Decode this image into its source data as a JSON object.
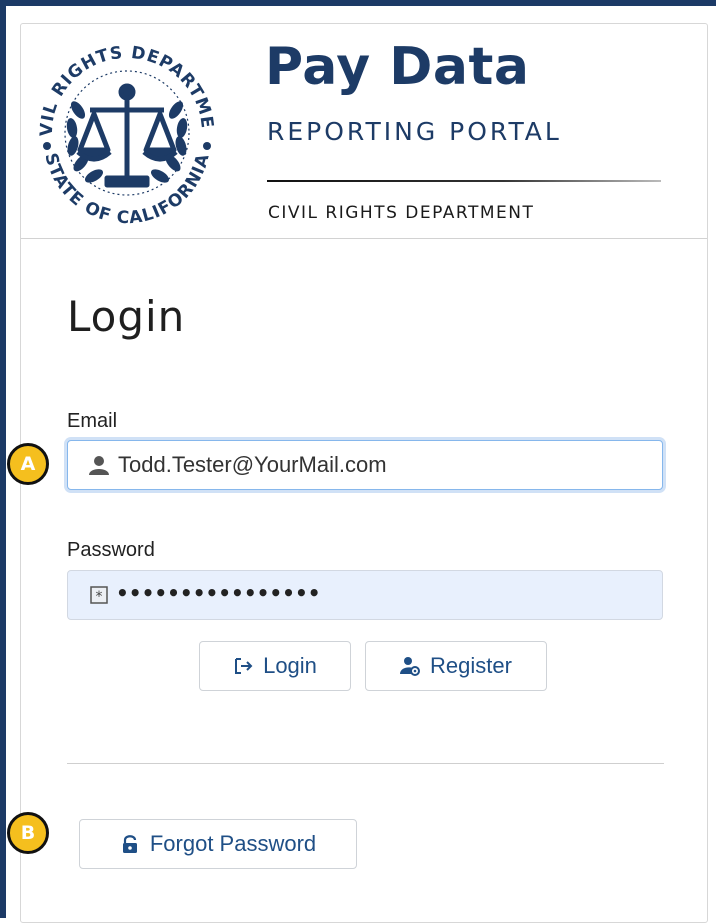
{
  "header": {
    "title": "Pay Data",
    "subtitle": "REPORTING PORTAL",
    "department": "CIVIL RIGHTS DEPARTMENT",
    "seal": {
      "top_text": "CIVIL RIGHTS DEPARTMENT",
      "bottom_text": "STATE OF CALIFORNIA",
      "icon": "scales-of-justice-icon"
    }
  },
  "login": {
    "heading": "Login",
    "email": {
      "label": "Email",
      "value": "Todd.Tester@YourMail.com",
      "icon": "user-icon"
    },
    "password": {
      "label": "Password",
      "value": "••••••••••••••••",
      "icon": "password-field-icon"
    },
    "buttons": {
      "login_label": "Login",
      "login_icon": "sign-in-icon",
      "register_label": "Register",
      "register_icon": "user-gear-icon",
      "forgot_label": "Forgot Password",
      "forgot_icon": "unlock-icon"
    }
  },
  "callouts": {
    "a": "A",
    "b": "B"
  },
  "colors": {
    "brand_navy": "#1d3b66",
    "link_blue": "#1f4f86",
    "callout_fill": "#f5bf1e",
    "autofill_bg": "#e8f0fd",
    "focus_border": "#86b7ec"
  }
}
